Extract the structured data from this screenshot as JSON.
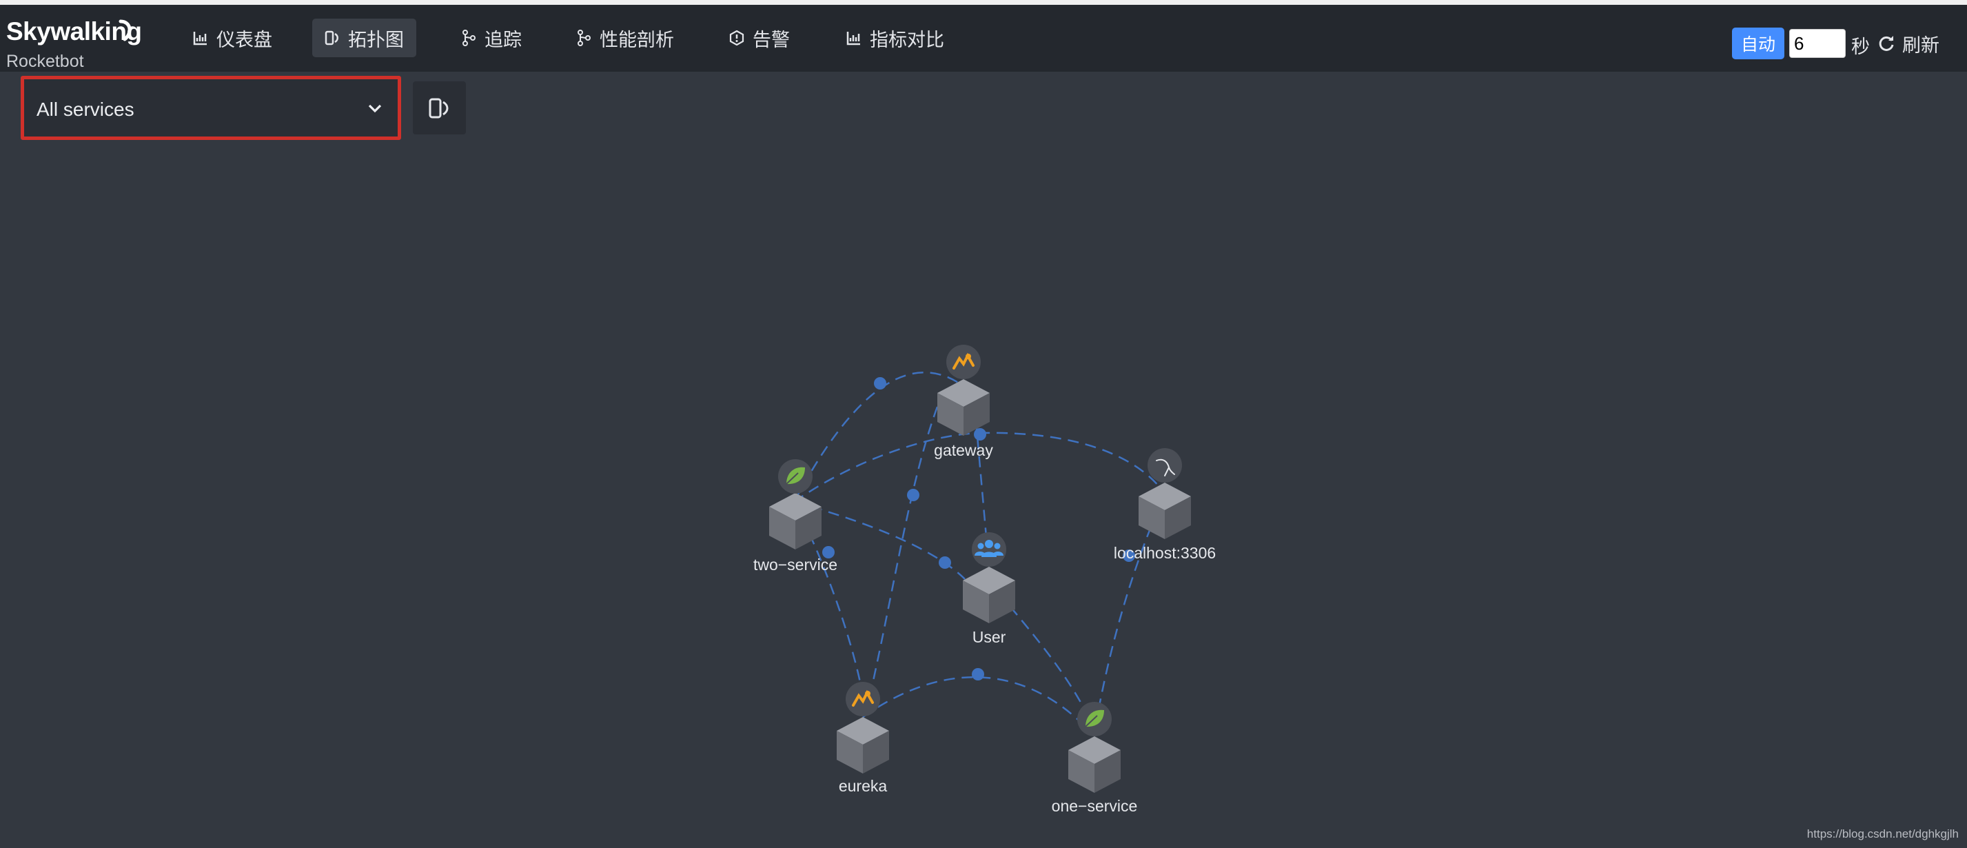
{
  "logo": {
    "title": "Skywalking",
    "subtitle": "Rocketbot"
  },
  "nav": [
    {
      "label": "仪表盘",
      "icon": "chart-icon"
    },
    {
      "label": "拓扑图",
      "icon": "topology-icon",
      "active": true
    },
    {
      "label": "追踪",
      "icon": "trace-icon"
    },
    {
      "label": "性能剖析",
      "icon": "profile-icon"
    },
    {
      "label": "告警",
      "icon": "alarm-icon"
    },
    {
      "label": "指标对比",
      "icon": "compare-icon"
    }
  ],
  "controls": {
    "auto_label": "自动",
    "interval_value": "6",
    "seconds_label": "秒",
    "refresh_label": "刷新"
  },
  "service_selector": {
    "selected": "All services"
  },
  "topology": {
    "nodes": [
      {
        "id": "gateway",
        "label": "gateway",
        "icon": "tomcat-icon"
      },
      {
        "id": "two-service",
        "label": "two−service",
        "icon": "spring-leaf-icon"
      },
      {
        "id": "localhost",
        "label": "localhost:3306",
        "icon": "mysql-icon"
      },
      {
        "id": "user",
        "label": "User",
        "icon": "users-icon"
      },
      {
        "id": "eureka",
        "label": "eureka",
        "icon": "tomcat-icon"
      },
      {
        "id": "one-service",
        "label": "one−service",
        "icon": "spring-leaf-icon"
      }
    ]
  },
  "watermark": "https://blog.csdn.net/dghkgjlh",
  "colors": {
    "accent": "#448dfe",
    "highlight_border": "#d0302a",
    "edge": "#3f72c0"
  }
}
